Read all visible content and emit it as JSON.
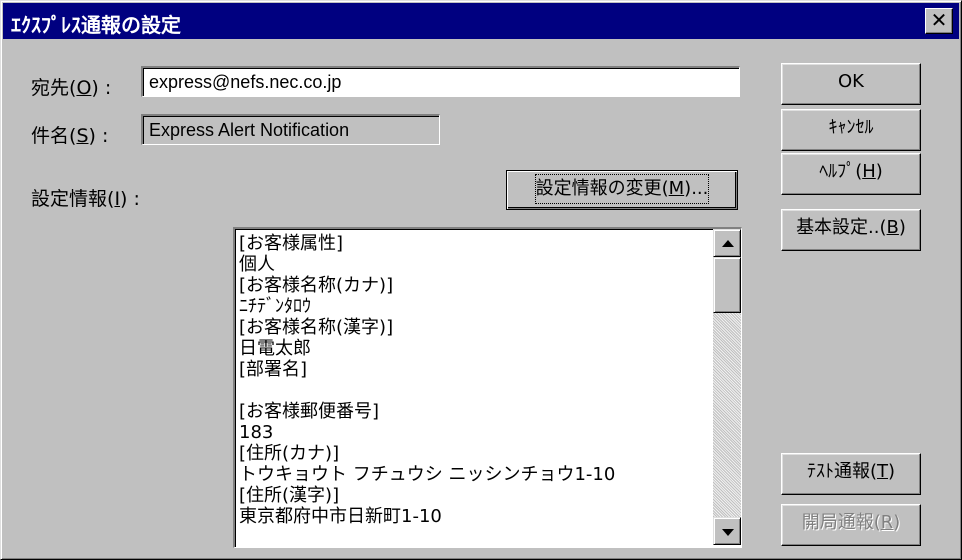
{
  "window": {
    "title": "ｴｸｽﾌﾟﾚｽ通報の設定",
    "close_glyph": "✕"
  },
  "form": {
    "to_label": "宛先",
    "to_mnemonic": "O",
    "to_value": "express@nefs.nec.co.jp",
    "subject_label": "件名",
    "subject_mnemonic": "S",
    "subject_value": "Express Alert Notification",
    "settings_label": "設定情報",
    "settings_mnemonic": "I",
    "label_suffix": ":",
    "change_button": "設定情報の変更",
    "change_mnemonic": "M",
    "change_ellipsis": "..."
  },
  "settings_lines": [
    "[お客様属性]",
    "個人",
    "[お客様名称(カナ)]",
    "ﾆﾁﾃﾞﾝﾀﾛｳ",
    "[お客様名称(漢字)]",
    "日電太郎",
    "[部署名]",
    "",
    "[お客様郵便番号]",
    "183",
    "[住所(カナ)]",
    "トウキョウト フチュウシ ニッシンチョウ1-10",
    "[住所(漢字)]",
    "東京都府中市日新町1-10"
  ],
  "buttons": {
    "ok": "OK",
    "cancel": "ｷｬﾝｾﾙ",
    "help": "ﾍﾙﾌﾟ",
    "help_mnemonic": "H",
    "basic": "基本設定..",
    "basic_mnemonic": "B",
    "test": "ﾃｽﾄ通報",
    "test_mnemonic": "T",
    "open": "開局通報",
    "open_mnemonic": "R"
  },
  "scrollbar": {
    "position_fraction": 0.0
  }
}
